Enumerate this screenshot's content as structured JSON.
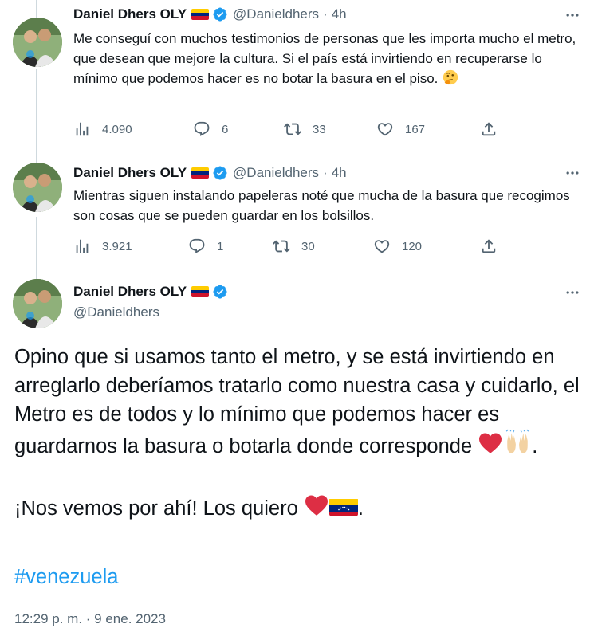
{
  "author": {
    "name": "Daniel Dhers OLY",
    "handle": "@Danieldhers",
    "flag_icon": "venezuela-flag",
    "verified_icon": "verified-badge"
  },
  "colors": {
    "accent": "#1d9bf0",
    "secondary_text": "#536471",
    "thread_line": "#cfd9de"
  },
  "tweets": [
    {
      "time": "4h",
      "text": "Me conseguí con muchos testimonios de personas que les importa mucho el metro, que desean que mejore la cultura. Si el país está invirtiendo en recuperarse lo mínimo que podemos hacer es no botar la basura en el piso.",
      "trailing_emoji": "thinking-face",
      "views": "4.090",
      "replies": "6",
      "retweets": "33",
      "likes": "167"
    },
    {
      "time": "4h",
      "text": "Mientras siguen instalando papeleras noté que mucha de la basura que recogimos son cosas que se pueden guardar en los bolsillos.",
      "views": "3.921",
      "replies": "1",
      "retweets": "30",
      "likes": "120"
    }
  ],
  "main_tweet": {
    "paragraph1": "Opino que si usamos tanto el metro, y se está invirtiendo en arreglarlo deberíamos tratarlo como nuestra casa y cuidarlo, el Metro es de todos y lo mínimo que podemos hacer es guardarnos la basura o botarla donde corresponde",
    "paragraph1_emojis": [
      "red-heart",
      "raising-hands"
    ],
    "paragraph1_end": ".",
    "paragraph2": "¡Nos vemos por ahí! Los quiero",
    "paragraph2_emojis": [
      "red-heart",
      "venezuela-flag"
    ],
    "paragraph2_end": ".",
    "hashtag": "#venezuela",
    "timestamp": "12:29 p. m. · 9 ene. 2023"
  },
  "dot": "·"
}
